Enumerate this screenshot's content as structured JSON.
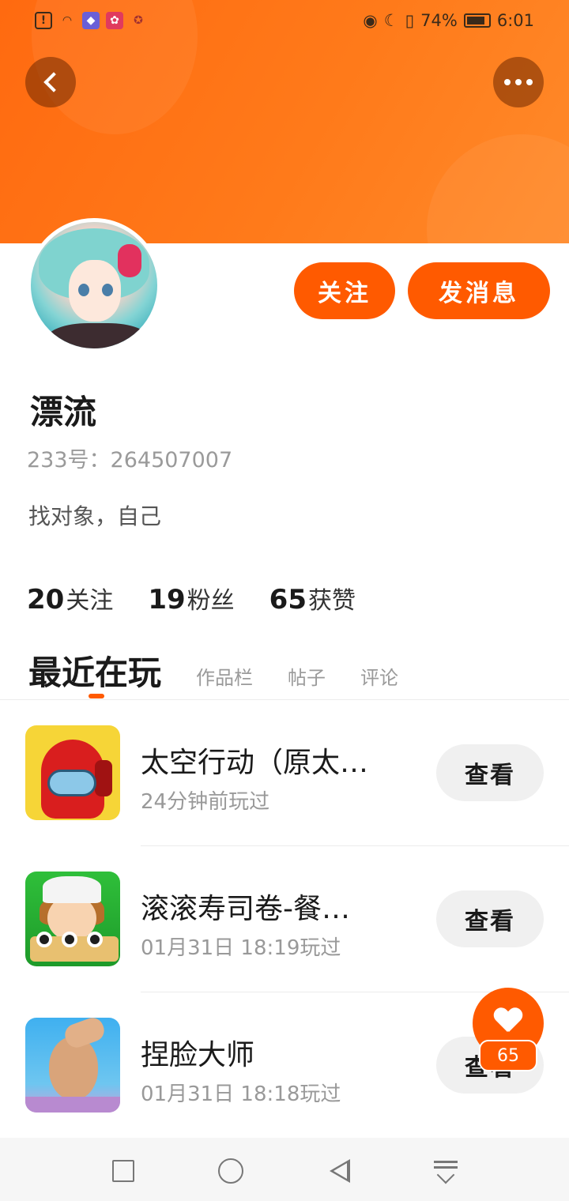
{
  "status_bar": {
    "battery": "74%",
    "time": "6:01"
  },
  "profile": {
    "follow_label": "关注",
    "message_label": "发消息",
    "name": "漂流",
    "id_text": "233号：264507007",
    "bio": "找对象，自己"
  },
  "stats": {
    "following_count": "20",
    "following_label": "关注",
    "fans_count": "19",
    "fans_label": "粉丝",
    "likes_count": "65",
    "likes_label": "获赞"
  },
  "tabs": [
    {
      "label": "最近在玩",
      "active": true
    },
    {
      "label": "作品栏",
      "active": false
    },
    {
      "label": "帖子",
      "active": false
    },
    {
      "label": "评论",
      "active": false
    }
  ],
  "games": [
    {
      "title": "太空行动（原太…",
      "time": "24分钟前玩过",
      "button": "查看"
    },
    {
      "title": "滚滚寿司卷-餐…",
      "time": "01月31日 18:19玩过",
      "button": "查看"
    },
    {
      "title": "捏脸大师",
      "time": "01月31日 18:18玩过",
      "button": "查看"
    }
  ],
  "like_fab": {
    "count": "65"
  },
  "colors": {
    "accent": "#ff5a00",
    "header": "#ff7a1a"
  }
}
